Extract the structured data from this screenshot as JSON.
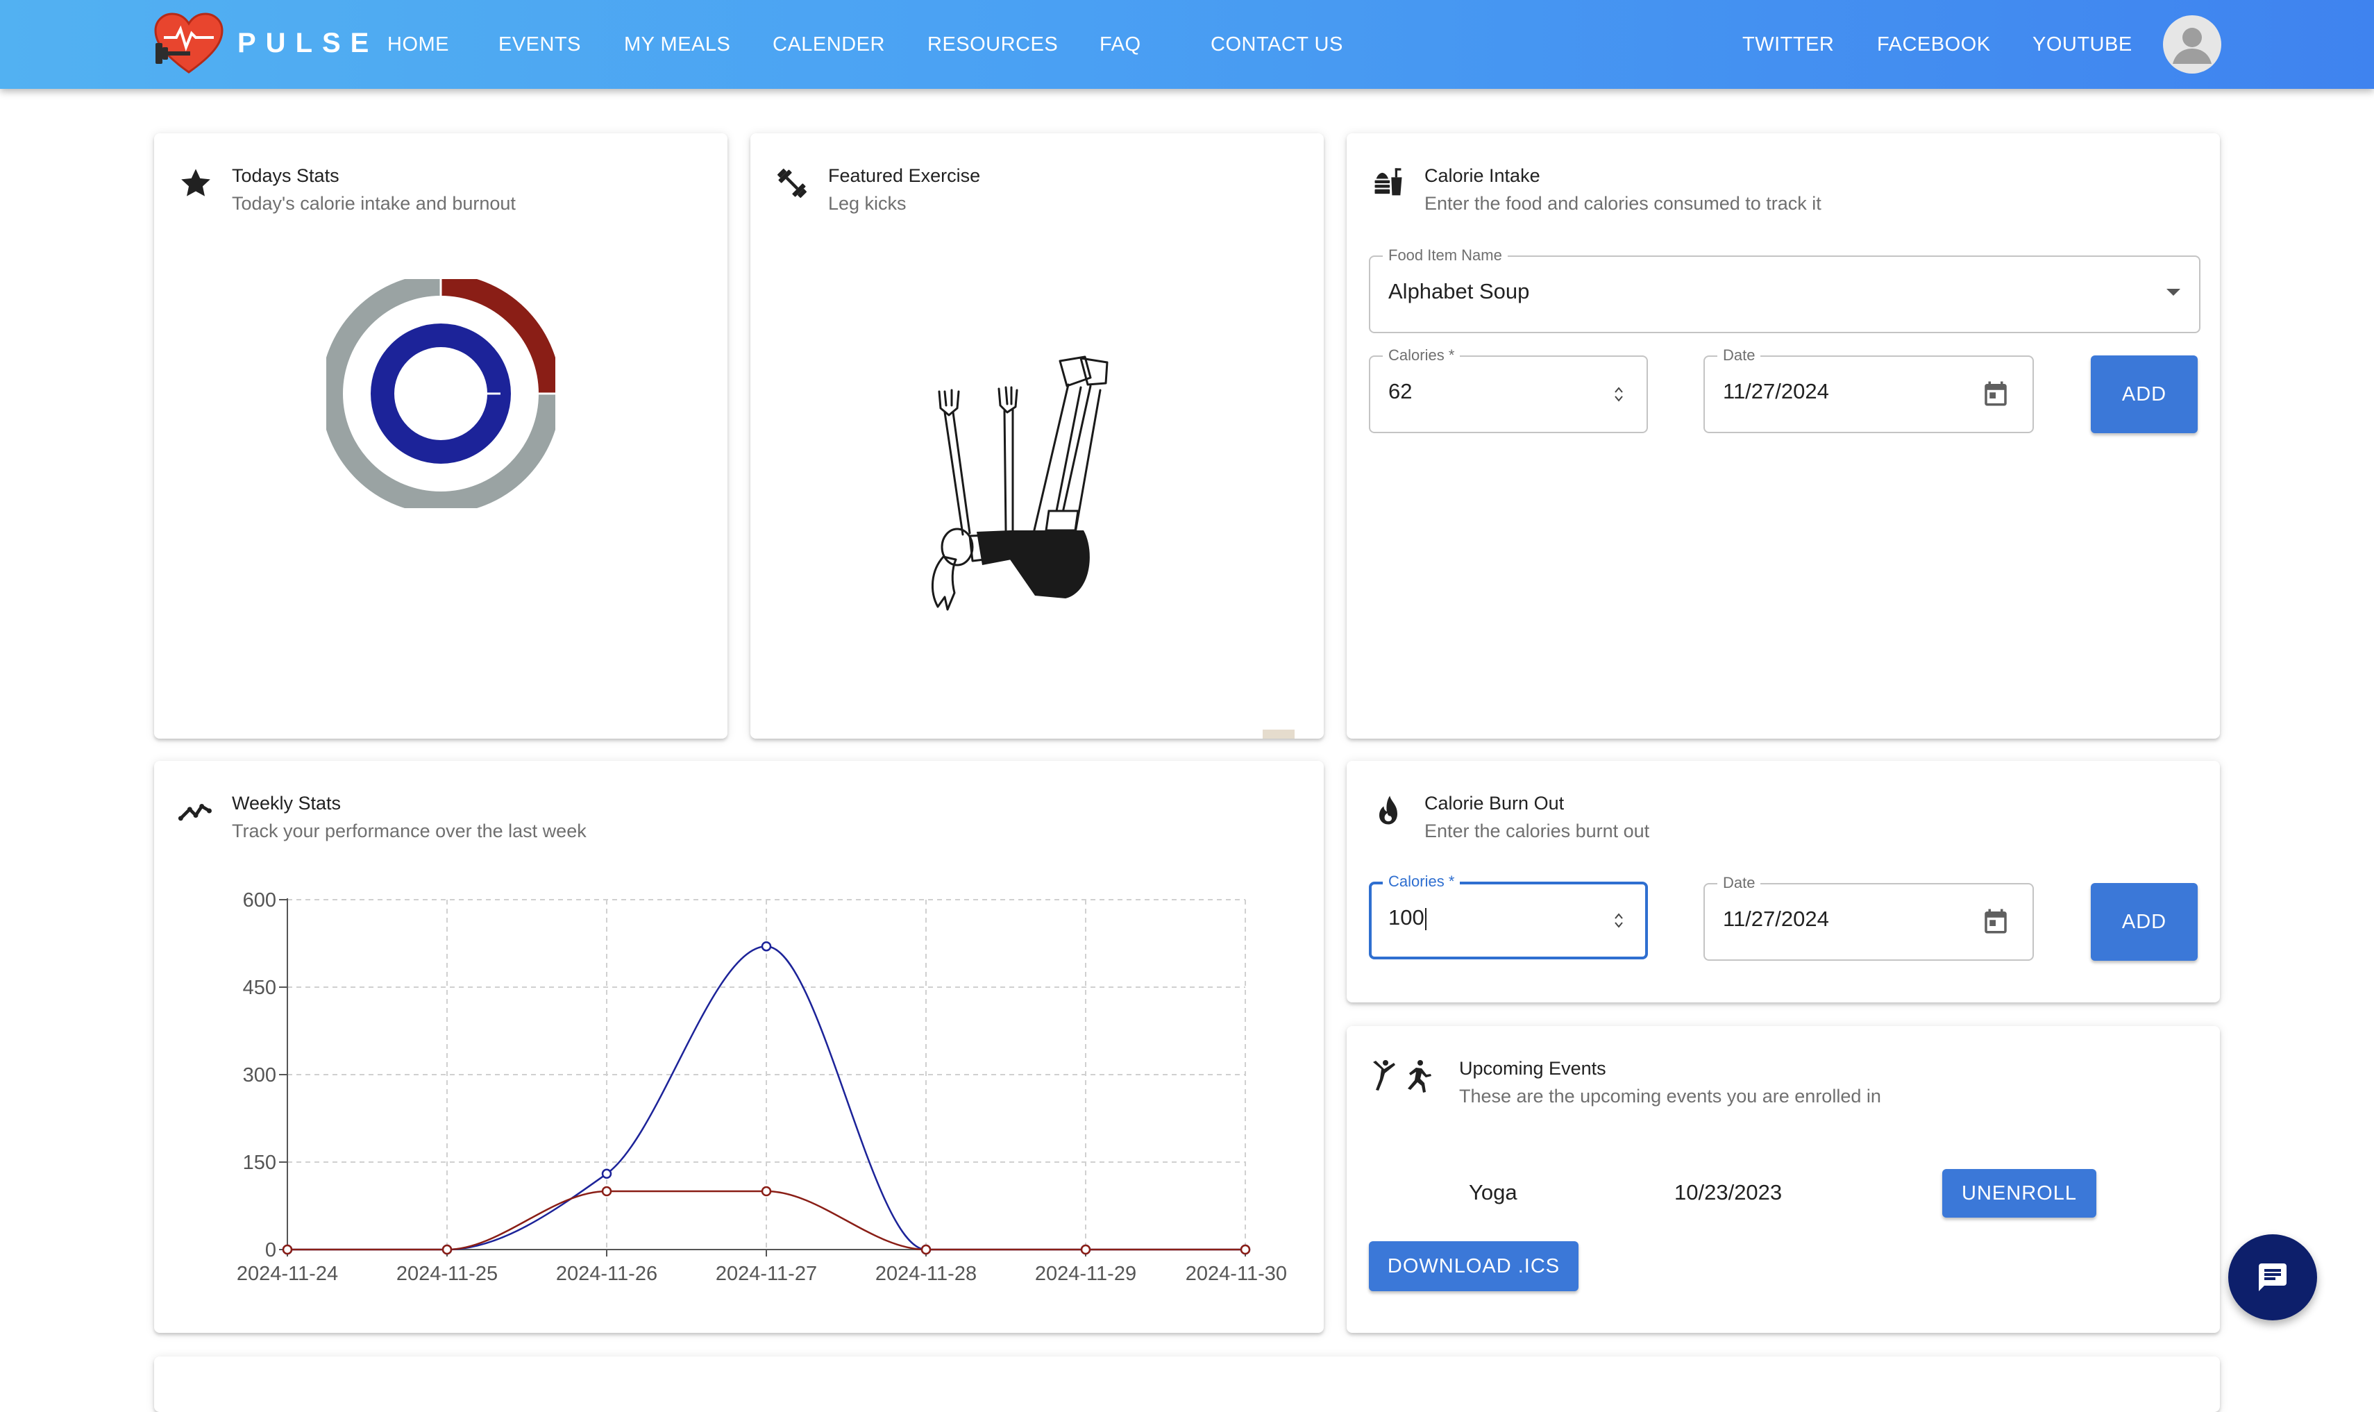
{
  "brand": {
    "name": "PULSE",
    "logo_icon": "heart-dumbbell-logo"
  },
  "nav": {
    "links": [
      "HOME",
      "EVENTS",
      "MY MEALS",
      "CALENDER",
      "RESOURCES",
      "FAQ",
      "CONTACT US"
    ],
    "social": [
      "TWITTER",
      "FACEBOOK",
      "YOUTUBE"
    ],
    "avatar_icon": "user-avatar-icon"
  },
  "colors": {
    "nav_start": "#52b1f2",
    "nav_end": "#3f83ef",
    "primary_button": "#3b78d8",
    "intake_series": "#1c2399",
    "burnout_series": "#8a1e16",
    "donut_gray": "#9aa3a3",
    "chat_fab": "#0d1f6b"
  },
  "todays_stats": {
    "title": "Todays Stats",
    "subtitle": "Today's calorie intake and burnout",
    "icon": "star-icon",
    "donut": {
      "outer_fraction_red": 0.25,
      "outer_fraction_gray": 0.75,
      "inner_fraction_blue": 1.0
    }
  },
  "featured_exercise": {
    "title": "Featured Exercise",
    "subtitle": "Leg kicks",
    "icon": "dumbbell-icon",
    "illustration": "leg-kicks-illustration"
  },
  "calorie_intake": {
    "title": "Calorie Intake",
    "subtitle": "Enter the food and calories consumed to track it",
    "icon": "fastfood-icon",
    "food_label": "Food Item Name",
    "food_value": "Alphabet Soup",
    "calories_label": "Calories",
    "calories_value": "62",
    "date_label": "Date",
    "date_value": "11/27/2024",
    "add_label": "ADD"
  },
  "calorie_burnout": {
    "title": "Calorie Burn Out",
    "subtitle": "Enter the calories burnt out",
    "icon": "fire-icon",
    "calories_label": "Calories",
    "calories_value": "100",
    "date_label": "Date",
    "date_value": "11/27/2024",
    "add_label": "ADD"
  },
  "weekly_stats": {
    "title": "Weekly Stats",
    "subtitle": "Track your performance over the last week",
    "icon": "trending-line-icon"
  },
  "upcoming_events": {
    "title": "Upcoming Events",
    "subtitle": "These are the upcoming events you are enrolled in",
    "icon": "martial-arts-running-icon",
    "events": [
      {
        "name": "Yoga",
        "date": "10/23/2023",
        "action": "UNENROLL"
      }
    ],
    "download_label": "DOWNLOAD .ICS"
  },
  "chat": {
    "icon": "chat-icon"
  },
  "chart_data": {
    "type": "line",
    "x": [
      "2024-11-24",
      "2024-11-25",
      "2024-11-26",
      "2024-11-27",
      "2024-11-28",
      "2024-11-29",
      "2024-11-30"
    ],
    "series": [
      {
        "color": "#1c2399",
        "values": [
          0,
          0,
          130,
          520,
          0,
          0,
          0
        ]
      },
      {
        "color": "#8a1e16",
        "values": [
          0,
          0,
          100,
          100,
          0,
          0,
          0
        ]
      }
    ],
    "yticks": [
      0,
      150,
      300,
      450,
      600
    ],
    "ylim": [
      0,
      600
    ],
    "grid": true,
    "smooth": true
  }
}
